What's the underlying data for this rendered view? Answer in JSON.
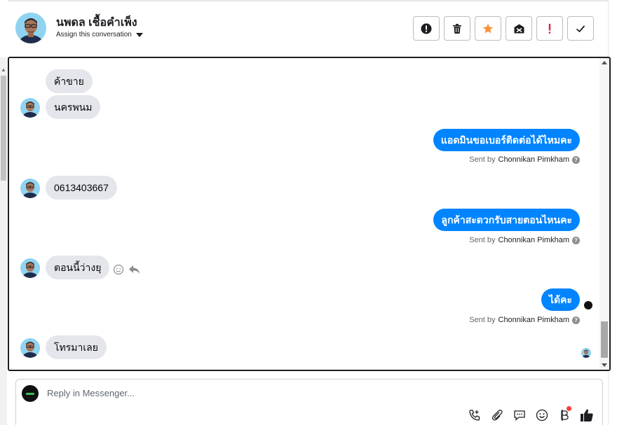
{
  "header": {
    "contact_name": "นพดล เชื้อคำเพ็ง",
    "assign_label": "Assign this conversation",
    "actions": [
      {
        "name": "mark-spam",
        "icon": "exclamation-circle-icon"
      },
      {
        "name": "delete",
        "icon": "trash-icon"
      },
      {
        "name": "star",
        "icon": "star-icon",
        "color": "#f7923a"
      },
      {
        "name": "mark-unread",
        "icon": "envelope-x-icon"
      },
      {
        "name": "follow-up",
        "icon": "exclamation-icon",
        "color": "#e41e3f"
      },
      {
        "name": "mark-done",
        "icon": "checkmark-icon"
      }
    ]
  },
  "messages": [
    {
      "dir": "in",
      "text": "ค้าขาย"
    },
    {
      "dir": "in",
      "text": "นครพนม"
    },
    {
      "dir": "out",
      "text": "แอดมินขอเบอร์ติดต่อได้ไหมคะ",
      "sent_by_prefix": "Sent by",
      "sent_by_name": "Chonnikan Pimkham"
    },
    {
      "dir": "in",
      "text": "0613403667"
    },
    {
      "dir": "out",
      "text": "ลูกค้าสะดวกรับสายตอนไหนคะ",
      "sent_by_prefix": "Sent by",
      "sent_by_name": "Chonnikan Pimkham"
    },
    {
      "dir": "in",
      "text": "ตอนนี้ว่างยุ"
    },
    {
      "dir": "out",
      "text": "ได้คะ",
      "sent_by_prefix": "Sent by",
      "sent_by_name": "Chonnikan Pimkham"
    },
    {
      "dir": "in",
      "text": "โทรมาเลย"
    }
  ],
  "sent_help": "?",
  "composer": {
    "placeholder": "Reply in Messenger...",
    "tools": [
      "call-add-icon",
      "paperclip-icon",
      "saved-reply-icon",
      "emoji-icon",
      "baht-icon",
      "thumbs-up-icon"
    ]
  },
  "colors": {
    "outgoing": "#0084ff",
    "incoming": "#e4e6eb",
    "accent_star": "#f7923a",
    "alert_red": "#e41e3f"
  }
}
